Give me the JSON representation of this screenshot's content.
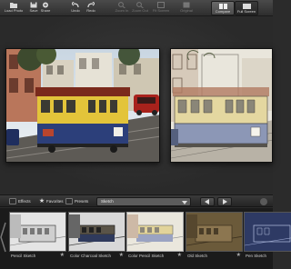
{
  "toolbar": {
    "buttons": [
      {
        "id": "load-photo",
        "label": "Load Photo",
        "icon": "folder-icon",
        "enabled": true
      },
      {
        "id": "save",
        "label": "Save",
        "icon": "save-icon",
        "enabled": true
      },
      {
        "id": "share",
        "label": "Share",
        "icon": "share-icon",
        "enabled": true
      },
      {
        "id": "undo",
        "label": "Undo",
        "icon": "undo-icon",
        "enabled": true
      },
      {
        "id": "redo",
        "label": "Redo",
        "icon": "redo-icon",
        "enabled": true
      },
      {
        "id": "zoom-in",
        "label": "Zoom In",
        "icon": "zoom-in-icon",
        "enabled": false
      },
      {
        "id": "zoom-out",
        "label": "Zoom Out",
        "icon": "zoom-out-icon",
        "enabled": false
      },
      {
        "id": "fit-screen",
        "label": "Fit Screen",
        "icon": "fit-screen-icon",
        "enabled": false
      },
      {
        "id": "original",
        "label": "Original",
        "icon": "original-icon",
        "enabled": false
      }
    ],
    "view_modes": [
      {
        "id": "compare",
        "label": "Compare",
        "active": true
      },
      {
        "id": "fullscreen",
        "label": "Full Screen",
        "active": false
      }
    ]
  },
  "filterbar": {
    "effects_label": "Effects",
    "favorites_label": "Favorites",
    "presets_label": "Presets",
    "category": "Sketch"
  },
  "filmstrip": {
    "thumbnails": [
      {
        "name": "Pencil Sketch",
        "style": "pencil",
        "selected": false
      },
      {
        "name": "Color Charcoal Sketch",
        "style": "charcoal",
        "selected": false
      },
      {
        "name": "Color Pencil Sketch",
        "style": "colorpencil",
        "selected": true
      },
      {
        "name": "Old Sketch",
        "style": "old",
        "selected": false
      },
      {
        "name": "Pen Sketch",
        "style": "pen",
        "selected": false
      }
    ]
  },
  "colors": {
    "accent": "#6a6a6a",
    "background": "#2b2b2b",
    "tram_yellow": "#e3c43a",
    "tram_blue": "#2c3f7a",
    "tram_red": "#8a2a1e"
  }
}
